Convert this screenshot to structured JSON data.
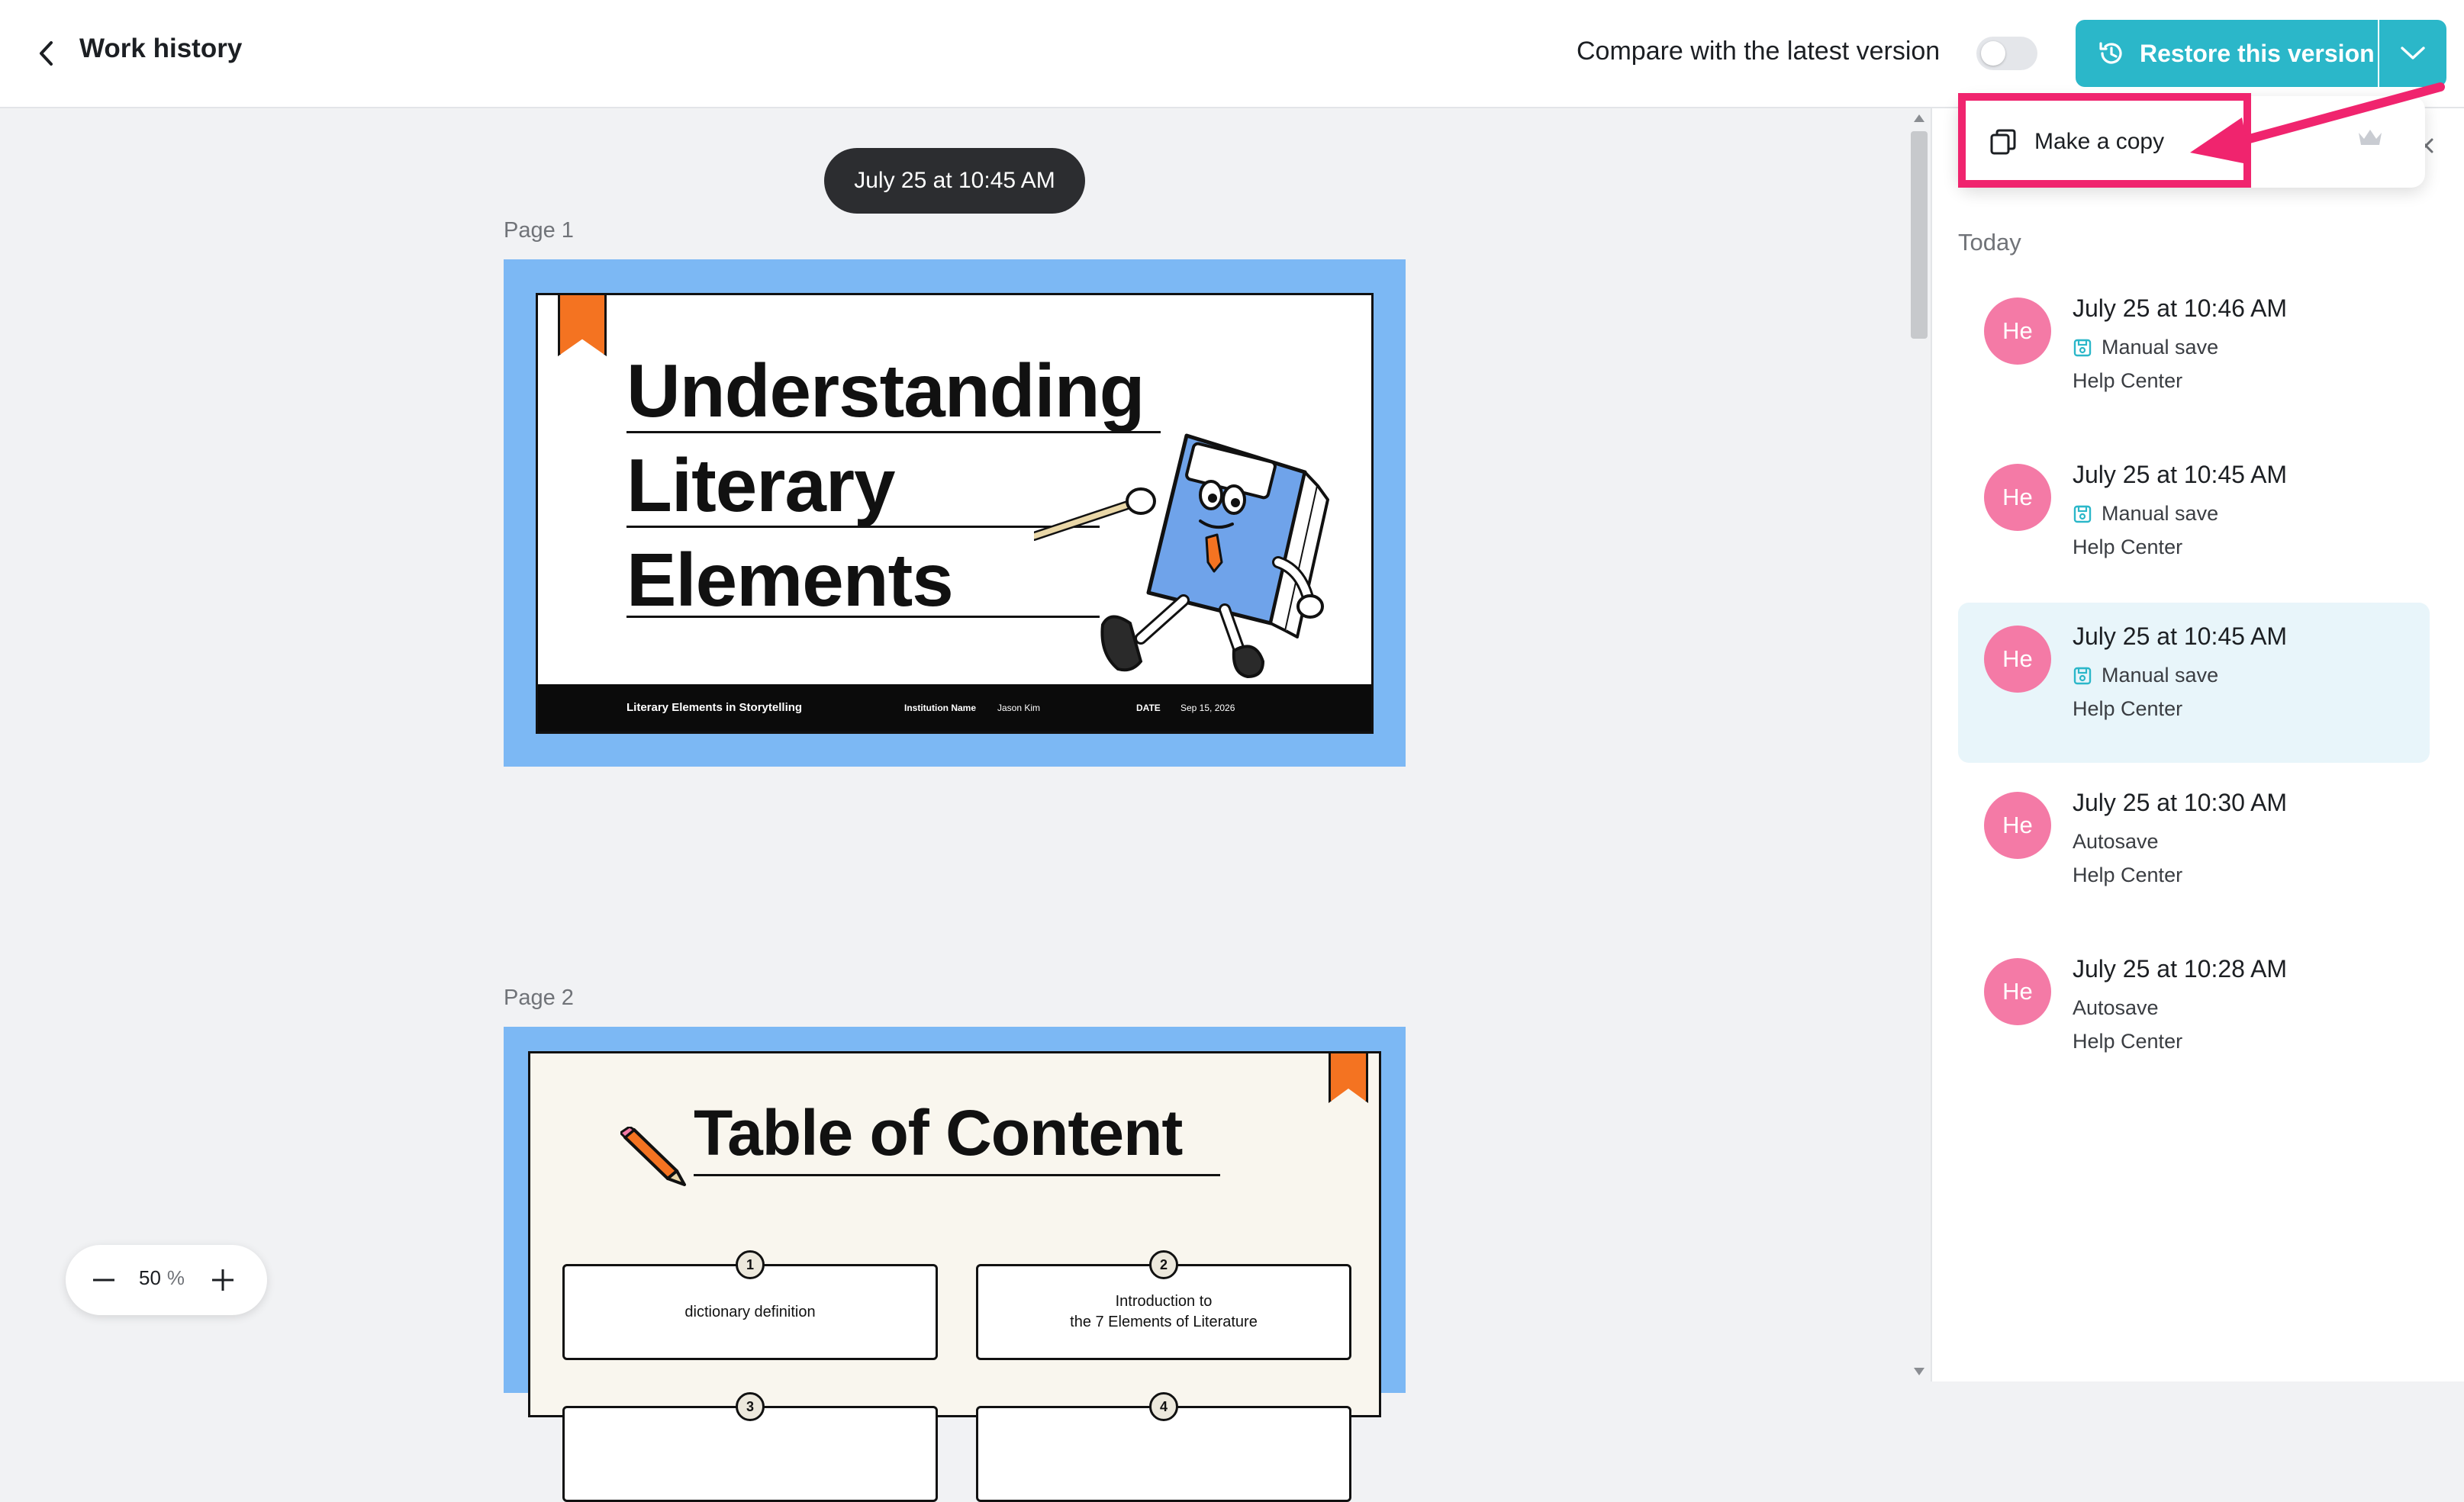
{
  "header": {
    "title": "Work history",
    "compare_label": "Compare with the latest version",
    "compare_enabled": false,
    "restore_label": "Restore this version"
  },
  "dropdown": {
    "make_copy_label": "Make a copy"
  },
  "canvas": {
    "date_pill": "July 25 at 10:45 AM",
    "pages": [
      {
        "label": "Page 1",
        "title_lines": [
          "Understanding",
          "Literary",
          "Elements"
        ],
        "footer": {
          "subject": "Literary Elements in Storytelling",
          "institution_label": "Institution Name",
          "institution_value": "Jason Kim",
          "date_label": "DATE",
          "date_value": "Sep 15, 2026"
        }
      },
      {
        "label": "Page 2",
        "title": "Table of Content",
        "items": [
          {
            "num": "1",
            "text": "dictionary definition"
          },
          {
            "num": "2",
            "text_line1": "Introduction to",
            "text_line2": "the 7 Elements of Literature"
          },
          {
            "num": "3"
          },
          {
            "num": "4"
          }
        ]
      }
    ]
  },
  "zoom": {
    "value": "50",
    "unit": "%"
  },
  "history": {
    "group_label": "Today",
    "versions": [
      {
        "avatar": "He",
        "time": "July 25 at 10:46 AM",
        "type": "Manual save",
        "user": "Help Center",
        "selected": false
      },
      {
        "avatar": "He",
        "time": "July 25 at 10:45 AM",
        "type": "Manual save",
        "user": "Help Center",
        "selected": false
      },
      {
        "avatar": "He",
        "time": "July 25 at 10:45 AM",
        "type": "Manual save",
        "user": "Help Center",
        "selected": true
      },
      {
        "avatar": "He",
        "time": "July 25 at 10:30 AM",
        "type": "Autosave",
        "user": "Help Center",
        "selected": false
      },
      {
        "avatar": "He",
        "time": "July 25 at 10:28 AM",
        "type": "Autosave",
        "user": "Help Center",
        "selected": false
      }
    ]
  },
  "colors": {
    "accent": "#2bb7c9",
    "avatar": "#f47aa6",
    "highlight": "#f0246e",
    "slide_bg": "#7cb8f4",
    "ribbon": "#f47321"
  }
}
